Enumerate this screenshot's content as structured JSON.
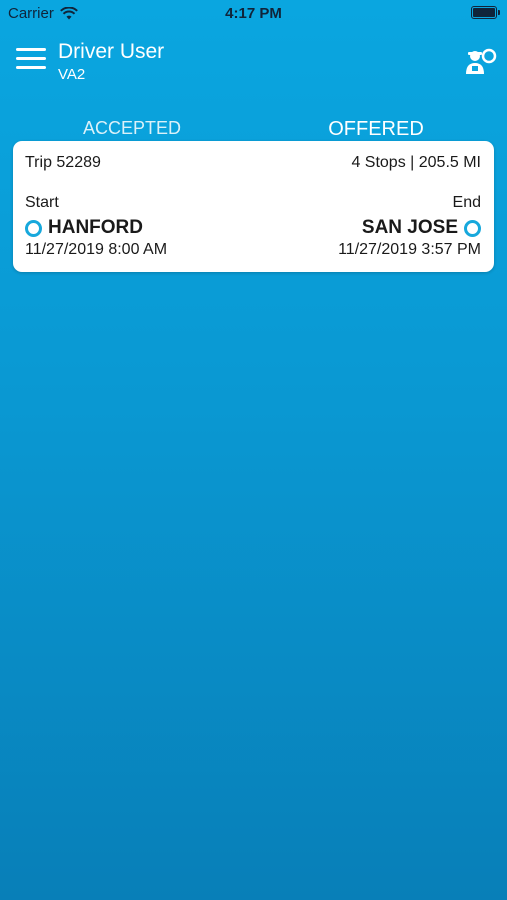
{
  "status_bar": {
    "carrier": "Carrier",
    "time": "4:17 PM",
    "icons": [
      "wifi-icon",
      "battery-icon"
    ]
  },
  "header": {
    "title": "Driver User",
    "subtitle": "VA2",
    "icons": [
      "menu-icon",
      "driver-profile-icon"
    ]
  },
  "tabs": [
    {
      "label": "ACCEPTED",
      "selected": false
    },
    {
      "label": "OFFERED",
      "selected": true
    }
  ],
  "trips": [
    {
      "trip_label": "Trip 52289",
      "summary": "4 Stops | 205.5 MI",
      "start_label": "Start",
      "start_city": "HANFORD",
      "start_time": "11/27/2019 8:00 AM",
      "end_label": "End",
      "end_city": "SAN JOSE",
      "end_time": "11/27/2019 3:57 PM"
    }
  ],
  "colors": {
    "background": "#0aa6e0",
    "accent": "#17a8dc",
    "card": "#ffffff"
  }
}
